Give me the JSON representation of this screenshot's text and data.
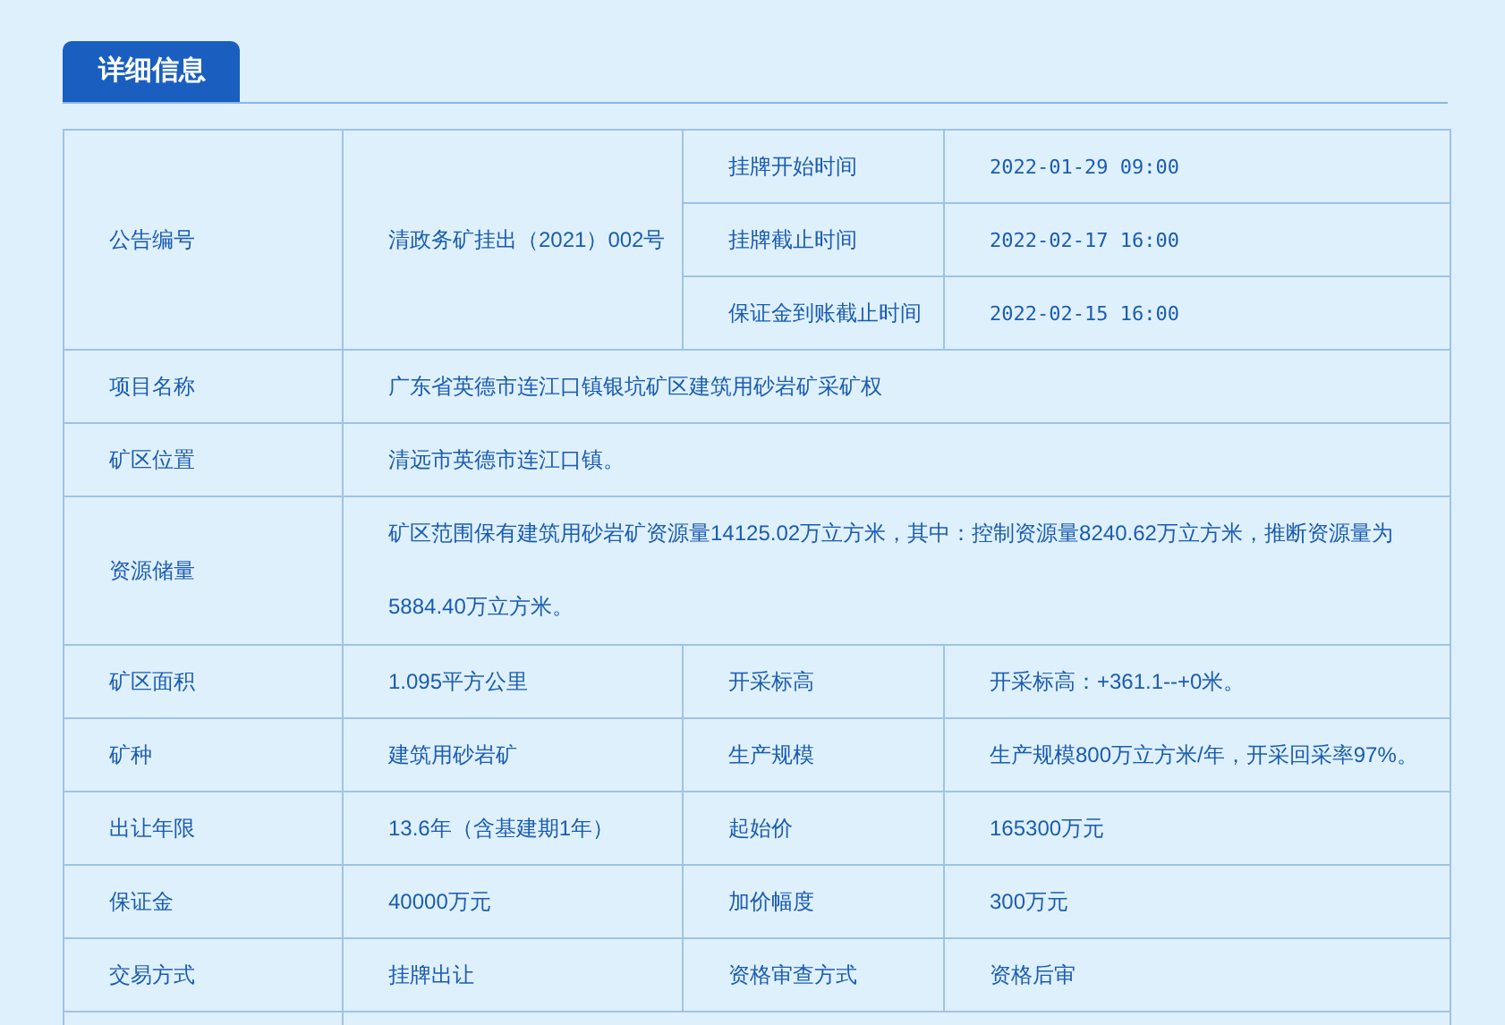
{
  "tab": {
    "label": "详细信息",
    "selected": true
  },
  "rows": [
    {
      "kind": "announcement",
      "label": "公告编号",
      "value": "清政务矿挂出（2021）002号",
      "sub_rows": [
        {
          "label": "挂牌开始时间",
          "value": "2022-01-29 09:00"
        },
        {
          "label": "挂牌截止时间",
          "value": "2022-02-17 16:00"
        },
        {
          "label": "保证金到账截止时间",
          "value": "2022-02-15 16:00"
        }
      ]
    },
    {
      "kind": "wide",
      "label": "项目名称",
      "value": "广东省英德市连江口镇银坑矿区建筑用砂岩矿采矿权"
    },
    {
      "kind": "wide",
      "label": "矿区位置",
      "value": "清远市英德市连江口镇。"
    },
    {
      "kind": "tall",
      "label": "资源储量",
      "value": "矿区范围保有建筑用砂岩矿资源量14125.02万立方米，其中：控制资源量8240.62万立方米，推断资源量为5884.40万立方米。"
    },
    {
      "kind": "pair",
      "label": "矿区面积",
      "value": "1.095平方公里",
      "label2": "开采标高",
      "value2": "开采标高：+361.1--+0米。"
    },
    {
      "kind": "pair",
      "label": "矿种",
      "value": "建筑用砂岩矿",
      "label2": "生产规模",
      "value2": "生产规模800万立方米/年，开采回采率97%。"
    },
    {
      "kind": "pair",
      "label": "出让年限",
      "value": "13.6年（含基建期1年）",
      "label2": "起始价",
      "value2": "165300万元"
    },
    {
      "kind": "pair",
      "label": "保证金",
      "value": "40000万元",
      "label2": "加价幅度",
      "value2": "300万元"
    },
    {
      "kind": "pair",
      "label": "交易方式",
      "value": "挂牌出让",
      "label2": "资格审查方式",
      "value2": "资格后审"
    }
  ]
}
